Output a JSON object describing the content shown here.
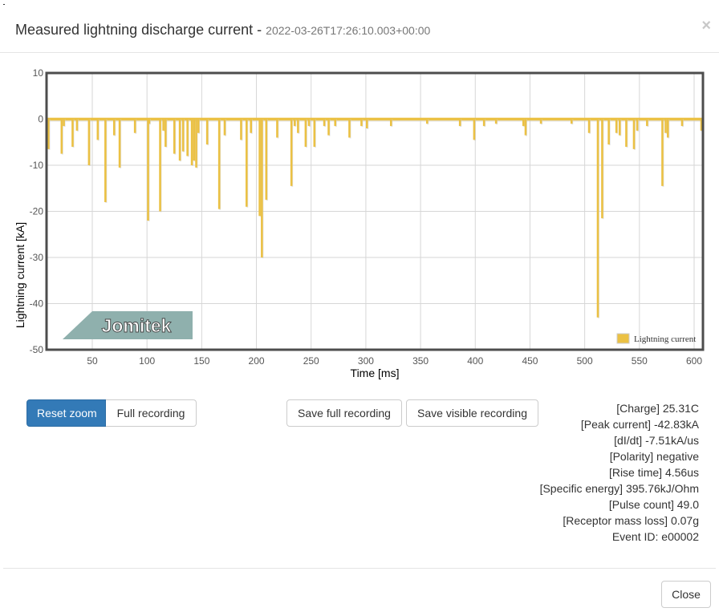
{
  "modal": {
    "title": "Measured lightning discharge current - ",
    "timestamp": "2022-03-26T17:26:10.003+00:00",
    "close_icon": "times-icon"
  },
  "chart_data": {
    "type": "line",
    "title": "",
    "xlabel": "Time [ms]",
    "ylabel": "Lightning current [kA]",
    "xlim": [
      10,
      608
    ],
    "ylim": [
      -50,
      10
    ],
    "xticks": [
      50,
      100,
      150,
      200,
      250,
      300,
      350,
      400,
      450,
      500,
      550,
      600
    ],
    "yticks": [
      10,
      0,
      -10,
      -20,
      -30,
      -40,
      -50
    ],
    "grid": true,
    "legend": {
      "placement": "bottom-right",
      "entries": [
        "Lightning current"
      ]
    },
    "watermark": "Jomitek",
    "series": [
      {
        "name": "Lightning current",
        "color": "#ebc144",
        "baseline": 0,
        "spikes": [
          [
            10,
            -6.5
          ],
          [
            22,
            -7.5
          ],
          [
            24,
            -1.5
          ],
          [
            32,
            -6
          ],
          [
            36,
            -2.5
          ],
          [
            47,
            -10
          ],
          [
            55,
            -4.5
          ],
          [
            62,
            -18
          ],
          [
            70,
            -3.5
          ],
          [
            75,
            -10.5
          ],
          [
            89,
            -3
          ],
          [
            101,
            -22
          ],
          [
            102,
            -1
          ],
          [
            112,
            -20
          ],
          [
            115,
            -2.5
          ],
          [
            117,
            -6
          ],
          [
            125,
            -7.5
          ],
          [
            130,
            -9
          ],
          [
            133,
            -7
          ],
          [
            137,
            -8
          ],
          [
            141,
            -10
          ],
          [
            143,
            -9
          ],
          [
            145,
            -10.5
          ],
          [
            147,
            -3
          ],
          [
            155,
            -5.5
          ],
          [
            166,
            -19.5
          ],
          [
            171,
            -3.5
          ],
          [
            186,
            -4.5
          ],
          [
            191,
            -19
          ],
          [
            195,
            -3
          ],
          [
            203,
            -21
          ],
          [
            205,
            -30
          ],
          [
            209,
            -17.5
          ],
          [
            219,
            -4
          ],
          [
            232,
            -14.5
          ],
          [
            235,
            -1.5
          ],
          [
            238,
            -3
          ],
          [
            245,
            -6
          ],
          [
            248,
            -1.5
          ],
          [
            253,
            -6
          ],
          [
            262,
            -1.5
          ],
          [
            266,
            -3.5
          ],
          [
            272,
            -1.5
          ],
          [
            285,
            -4
          ],
          [
            296,
            -1.5
          ],
          [
            301,
            -2
          ],
          [
            323,
            -1.5
          ],
          [
            356,
            -1
          ],
          [
            386,
            -1.5
          ],
          [
            399,
            -4.5
          ],
          [
            408,
            -1.5
          ],
          [
            419,
            -1
          ],
          [
            444,
            -1.5
          ],
          [
            446,
            -3.5
          ],
          [
            460,
            -1
          ],
          [
            488,
            -1
          ],
          [
            504,
            -3
          ],
          [
            512,
            -43
          ],
          [
            516,
            -21.5
          ],
          [
            522,
            -5.5
          ],
          [
            529,
            -3
          ],
          [
            532,
            -3.5
          ],
          [
            538,
            -6
          ],
          [
            545,
            -6.5
          ],
          [
            548,
            -2.5
          ],
          [
            557,
            -1.5
          ],
          [
            571,
            -14.5
          ],
          [
            574,
            -3
          ],
          [
            576,
            -4
          ],
          [
            589,
            -1.5
          ],
          [
            608,
            -2.5
          ]
        ]
      }
    ]
  },
  "buttons": {
    "reset_zoom": "Reset zoom",
    "full_recording": "Full recording",
    "save_full": "Save full recording",
    "save_visible": "Save visible recording",
    "close": "Close"
  },
  "info": {
    "charge": "[Charge] 25.31C",
    "peak_current": "[Peak current] -42.83kA",
    "didt": "[dI/dt] -7.51kA/us",
    "polarity": "[Polarity] negative",
    "rise_time": "[Rise time] 4.56us",
    "specific_energy": "[Specific energy] 395.76kJ/Ohm",
    "pulse_count": "[Pulse count] 49.0",
    "mass_loss": "[Receptor mass loss] 0.07g",
    "event_id": "Event ID: e00002"
  }
}
